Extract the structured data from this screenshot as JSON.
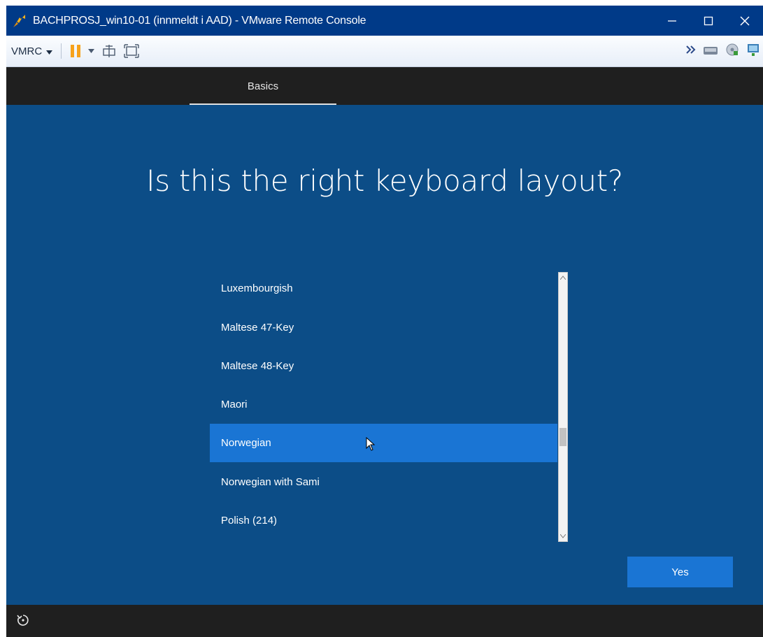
{
  "window": {
    "title": "BACHPROSJ_win10-01 (innmeldt i AAD) - VMware Remote Console",
    "controls": [
      "minimize-icon",
      "maximize-icon",
      "close-icon"
    ]
  },
  "toolbar": {
    "vmrc_label": "VMRC",
    "icons": [
      "pause-icon",
      "send-ctrl-alt-del-icon",
      "fullscreen-icon",
      "expand-icon",
      "removable-devices-icon",
      "cd-icon",
      "network-icon"
    ]
  },
  "header": {
    "tab_label": "Basics"
  },
  "main": {
    "heading": "Is this the right keyboard layout?",
    "layouts": [
      {
        "label": "Luxembourgish",
        "selected": false
      },
      {
        "label": "Maltese 47-Key",
        "selected": false
      },
      {
        "label": "Maltese 48-Key",
        "selected": false
      },
      {
        "label": "Maori",
        "selected": false
      },
      {
        "label": "Norwegian",
        "selected": true
      },
      {
        "label": "Norwegian with Sami",
        "selected": false
      },
      {
        "label": "Polish (214)",
        "selected": false
      }
    ],
    "yes_label": "Yes"
  },
  "colors": {
    "background": "#0c4d87",
    "accent": "#1a75d4",
    "titlebar": "#003a88",
    "dark_bar": "#1f1f1f"
  },
  "footer": {
    "icons": [
      "ease-of-access-icon"
    ]
  }
}
